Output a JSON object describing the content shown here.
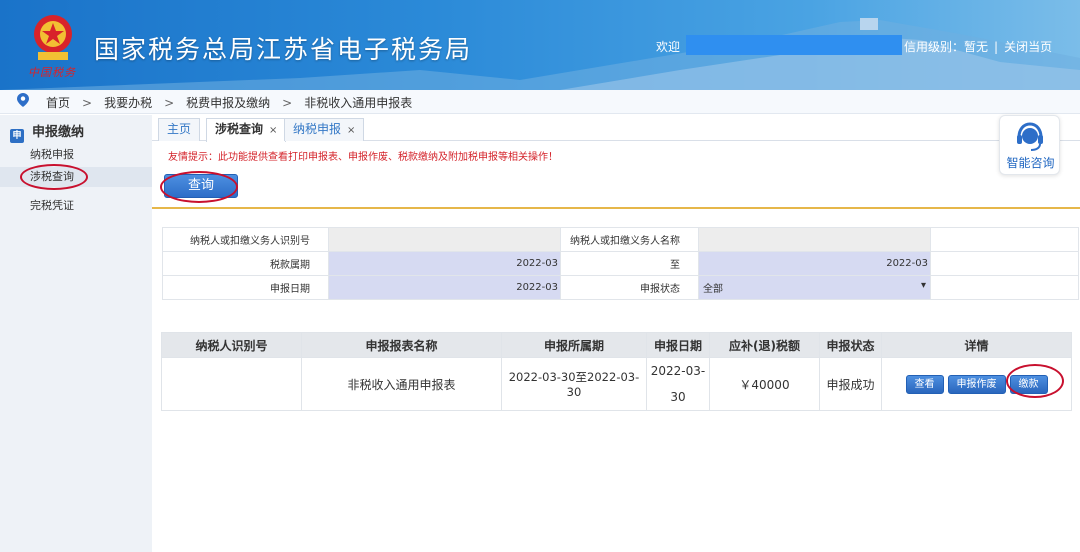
{
  "header": {
    "site_title": "国家税务总局江苏省电子税务局",
    "brand_script": "中国税务",
    "welcome": "欢迎",
    "credit_level": "信用级别：暂无",
    "separator": "|",
    "close_page": "关闭当页"
  },
  "breadcrumb": [
    "首页",
    "我要办税",
    "税费申报及缴纳",
    "非税收入通用申报表"
  ],
  "breadcrumb_sep": ">",
  "sidebar": {
    "heading_icon": "申",
    "heading": "申报缴纳",
    "items": [
      {
        "label": "纳税申报"
      },
      {
        "label": "涉税查询"
      },
      {
        "label": "完税凭证"
      }
    ]
  },
  "tabs": [
    {
      "label": "主页",
      "closable": false
    },
    {
      "label": "涉税查询",
      "closable": true
    },
    {
      "label": "纳税申报",
      "closable": true
    }
  ],
  "tab_close_glyph": "×",
  "notice": "友情提示：此功能提供查看打印申报表、申报作废、税款缴纳及附加税申报等相关操作！",
  "query_button": "查询",
  "form": {
    "taxpayer_id_label": "纳税人或扣缴义务人识别号",
    "taxpayer_id_value": "",
    "taxpayer_name_label": "纳税人或扣缴义务人名称",
    "taxpayer_name_value": "",
    "period_label": "税款属期",
    "period_from": "2022-03",
    "period_to_label": "至",
    "period_to": "2022-03",
    "declare_date_label": "申报日期",
    "declare_date": "2022-03",
    "status_label": "申报状态",
    "status_value": "全部",
    "status_caret": "▾"
  },
  "results": {
    "headers": [
      "纳税人识别号",
      "申报报表名称",
      "申报所属期",
      "申报日期",
      "应补(退)税额",
      "申报状态",
      "详情"
    ],
    "rows": [
      {
        "taxpayer_id": "",
        "form_name": "非税收入通用申报表",
        "period": "2022-03-30至2022-03-30",
        "declare_date": "2022-03-30",
        "amount": "￥40000",
        "status": "申报成功",
        "actions": [
          "查看",
          "申报作废",
          "缴款"
        ]
      }
    ]
  },
  "consult": {
    "label": "智能咨询"
  },
  "colors": {
    "primary": "#2d6ec8",
    "notice_red": "#d4242b",
    "highlight_ellipse": "#c8102e",
    "gold_divider": "#e6b74a"
  }
}
